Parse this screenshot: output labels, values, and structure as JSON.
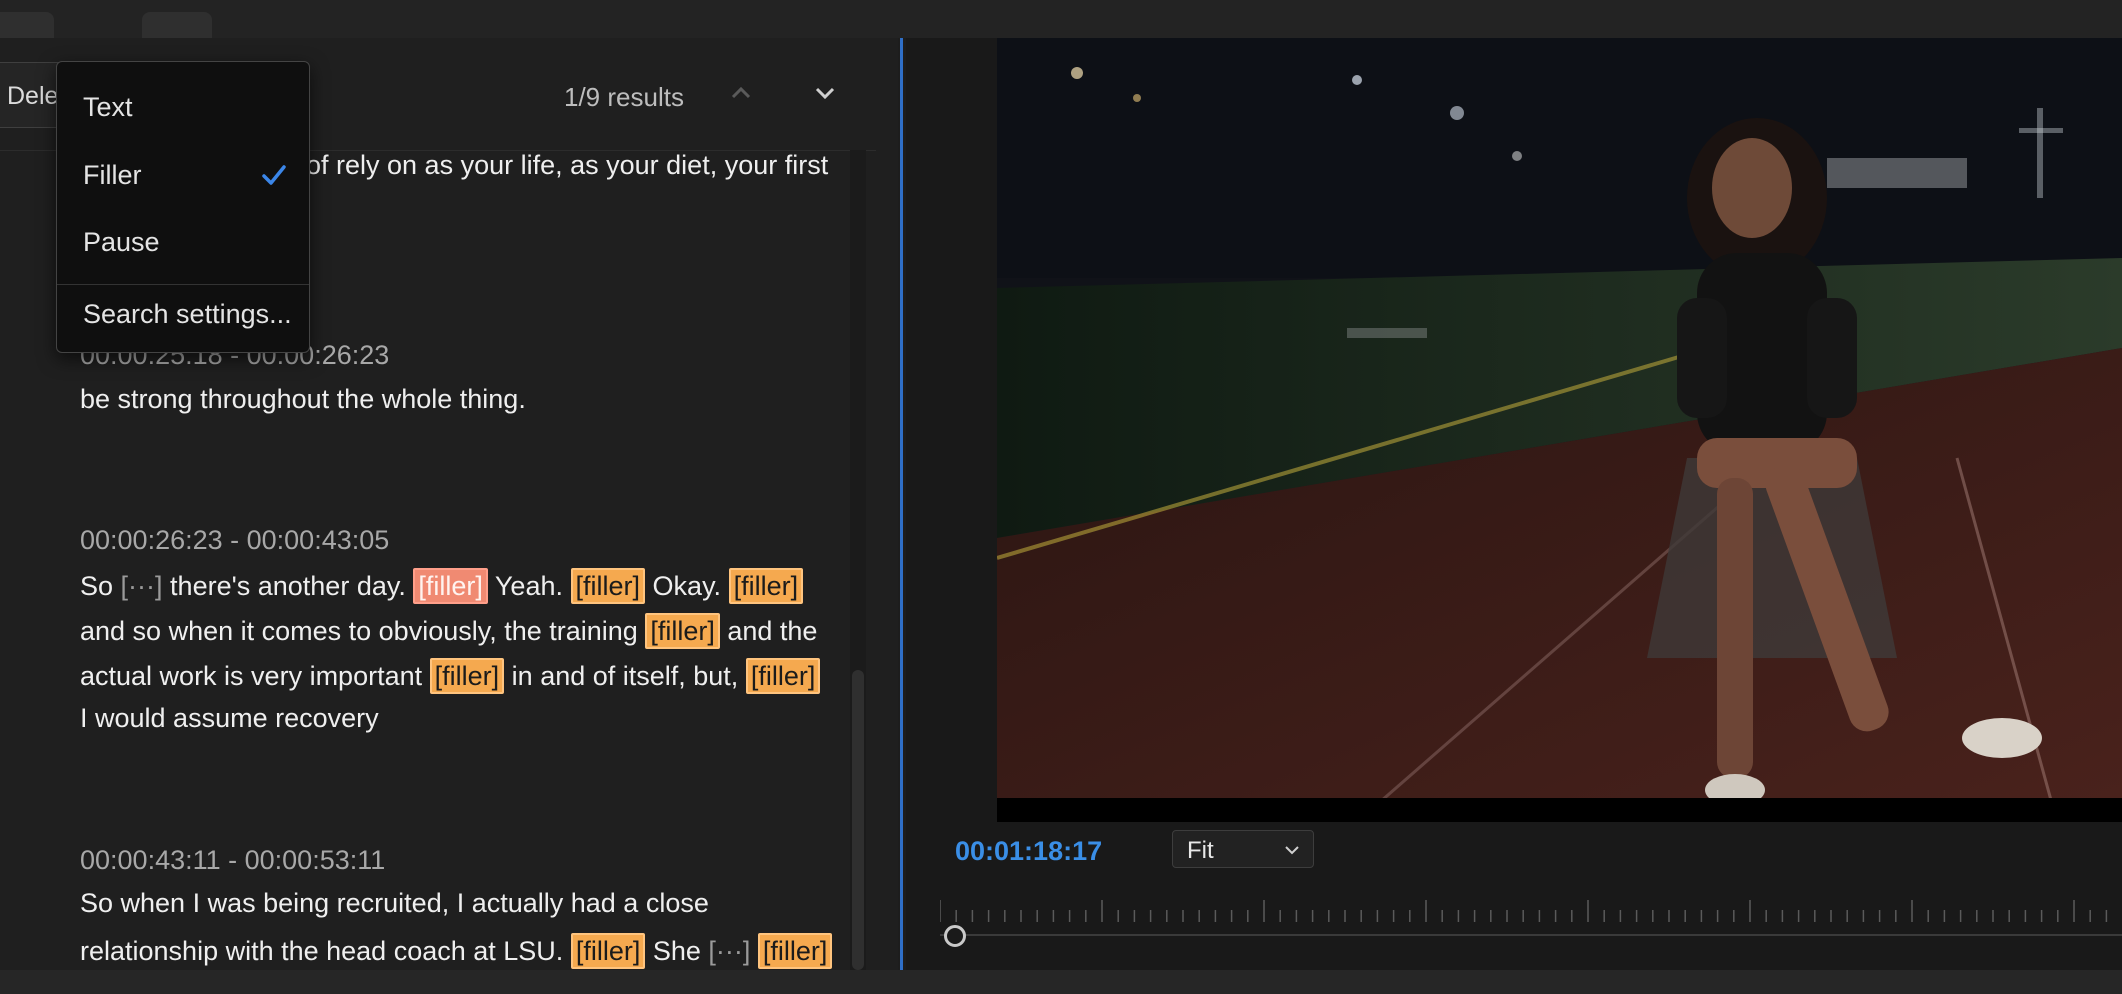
{
  "search": {
    "delete_label": "Dele",
    "results": "1/9 results"
  },
  "menu": {
    "items": [
      "Text",
      "Filler",
      "Pause",
      "Search settings..."
    ],
    "selected": "Filler"
  },
  "transcript": {
    "partial_line": "of rely on as your life, as your diet, your first",
    "segment1": {
      "time": "00:00:25:18 - 00:00:26:23",
      "text": "be strong throughout the whole thing."
    },
    "segment2": {
      "time": "00:00:26:23 - 00:00:43:05",
      "l1_a": "So",
      "pause": "[···]",
      "l1_b": "there's another day.",
      "filler": "[filler]",
      "l1_c": "Yeah.",
      "l1_d": "Okay.",
      "l2_a": "and so when it comes to obviously, the training",
      "l2_b": "and the",
      "l3_a": "actual work is very important",
      "l3_b": "in and of itself, but,",
      "l4": "I would assume recovery"
    },
    "segment3": {
      "time": "00:00:43:11 - 00:00:53:11",
      "l1": "So when I was being recruited, I actually had a close",
      "l2_a": "relationship with the head coach at LSU.",
      "l2_b": "She"
    }
  },
  "player": {
    "timecode": "00:01:18:17",
    "zoom": "Fit"
  },
  "colors": {
    "filler_highlight": "#f5a94f",
    "filler_active": "#f08a72",
    "accent_blue": "#3a8ee6"
  },
  "icons": [
    "chevron-up-icon",
    "chevron-down-icon",
    "checkmark-icon"
  ]
}
